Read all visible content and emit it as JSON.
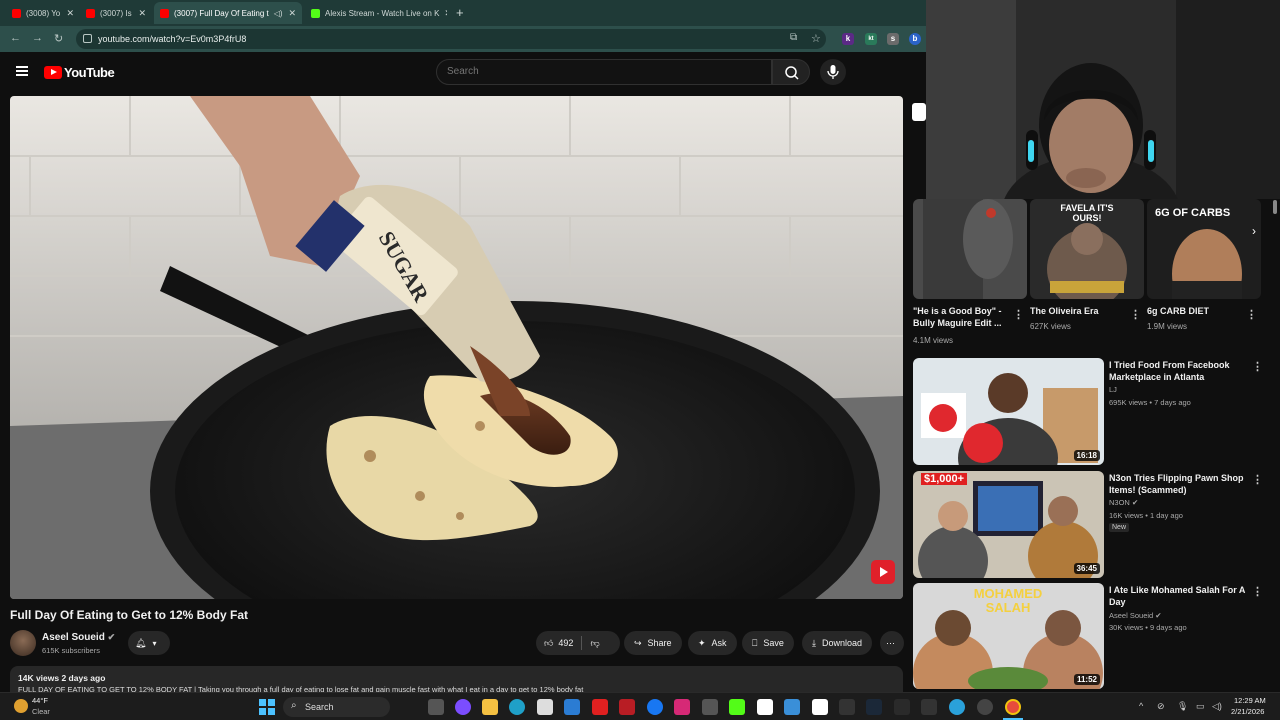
{
  "browser": {
    "tabs": [
      {
        "label": "(3008) Yo",
        "icon": "youtube-icon",
        "active": false
      },
      {
        "label": "(3007) Is",
        "icon": "youtube-icon",
        "active": false
      },
      {
        "label": "(3007) Full Day Of Eating t",
        "icon": "youtube-icon",
        "active": true
      },
      {
        "label": "Alexis Stream - Watch Live on K",
        "icon": "kick-icon",
        "active": false
      }
    ],
    "url": "youtube.com/watch?v=Ev0m3P4frU8",
    "extensions": [
      "k",
      "kt",
      "s",
      "b"
    ]
  },
  "youtube": {
    "logo_text": "YouTube",
    "search_placeholder": "Search"
  },
  "video": {
    "title": "Full Day Of Eating to Get to 12% Body Fat",
    "channel": "Aseel Soueid",
    "subscribers": "615K subscribers",
    "likes": "492",
    "share_label": "Share",
    "ask_label": "Ask",
    "save_label": "Save",
    "download_label": "Download",
    "meta": "14K views  2 days ago",
    "description": "FULL DAY OF EATING TO GET TO 12% BODY FAT | Taking you through a full day of eating to lose fat and gain muscle fast with what I eat in a day to get to 12% body fat"
  },
  "sidebar": {
    "shorts": [
      {
        "title": "\"He is a Good Boy\" - Bully Maguire Edit ...",
        "views": "4.1M views"
      },
      {
        "title": "The Oliveira Era",
        "views": "627K views",
        "overlay": "FAVELA IT'S OURS!"
      },
      {
        "title": "6g CARB DIET",
        "views": "1.9M views",
        "overlay": "6G OF CARBS"
      }
    ],
    "videos": [
      {
        "title": "I Tried Food From Facebook Marketplace in Atlanta",
        "channel": "LJ",
        "stats": "695K views • 7 days ago",
        "duration": "16:18",
        "badge": ""
      },
      {
        "title": "N3on Tries Flipping Pawn Shop Items! (Scammed)",
        "channel": "N3ON",
        "stats": "16K views • 1 day ago",
        "duration": "36:45",
        "badge": "New",
        "thumb_text": "$1,000+"
      },
      {
        "title": "I Ate Like Mohamed Salah For A Day",
        "channel": "Aseel Soueid",
        "stats": "30K views • 9 days ago",
        "duration": "11:52",
        "badge": "",
        "thumb_text": "MOHAMED SALAH"
      }
    ]
  },
  "taskbar": {
    "temp": "44°F",
    "weather": "Clear",
    "search_label": "Search",
    "time": "12:29 AM",
    "date": "2/21/2026"
  }
}
